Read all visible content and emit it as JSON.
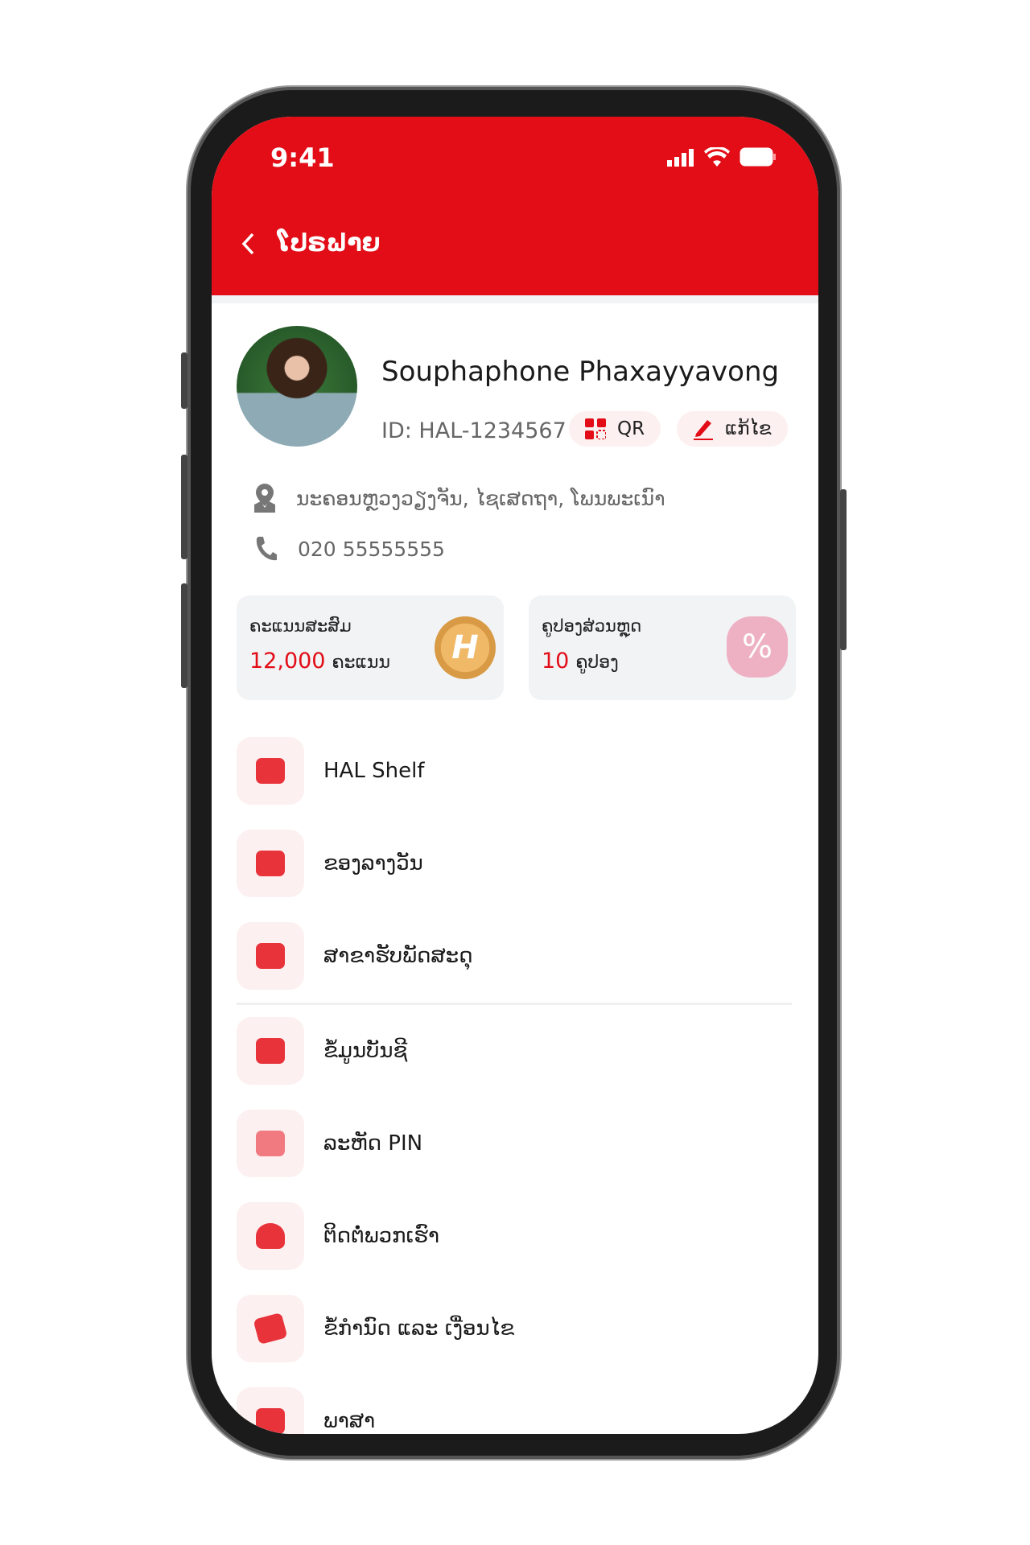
{
  "status_bar": {
    "time": "9:41"
  },
  "header": {
    "title": "ໂປຣຟາຍ",
    "back_icon": "chevron-left-icon"
  },
  "profile": {
    "name": "Souphaphone Phaxayyavong",
    "id": "ID: HAL-1234567",
    "qr_label": "QR",
    "edit_label": "ແກ້ໄຂ",
    "address": "ນະຄອນຫຼວງວຽງຈັນ, ໄຊເສດຖາ, ໂພນພະເນົາ",
    "phone": "020 55555555"
  },
  "cards": {
    "points": {
      "label": "ຄະແນນສະສົມ",
      "value": "12,000",
      "unit": "ຄະແນນ",
      "icon": "H"
    },
    "coupons": {
      "label": "ຄູປອງສ່ວນຫຼຸດ",
      "value": "10",
      "unit": "ຄູປອງ",
      "icon": "%"
    }
  },
  "menu": [
    {
      "label": "HAL Shelf",
      "icon": "shop-icon"
    },
    {
      "label": "ຂອງລາງວັນ",
      "icon": "gift-icon"
    },
    {
      "label": "ສາຂາຮັບພັດສະດຸ",
      "icon": "building-icon"
    },
    {
      "label": "ຂໍ້ມູນບັນຊີ",
      "icon": "id-card-icon"
    },
    {
      "label": "ລະຫັດ PIN",
      "icon": "pin-icon"
    },
    {
      "label": "ຕິດຕໍ່ພວກເຮົາ",
      "icon": "contact-icon"
    },
    {
      "label": "ຂໍ້ກຳນົດ ແລະ ເງື່ອນໄຂ",
      "icon": "terms-icon"
    },
    {
      "label": "ພາສາ",
      "icon": "language-icon"
    }
  ],
  "colors": {
    "accent": "#e20d17",
    "icon_bg": "#fdf0f0",
    "card_bg": "#f2f3f5"
  }
}
